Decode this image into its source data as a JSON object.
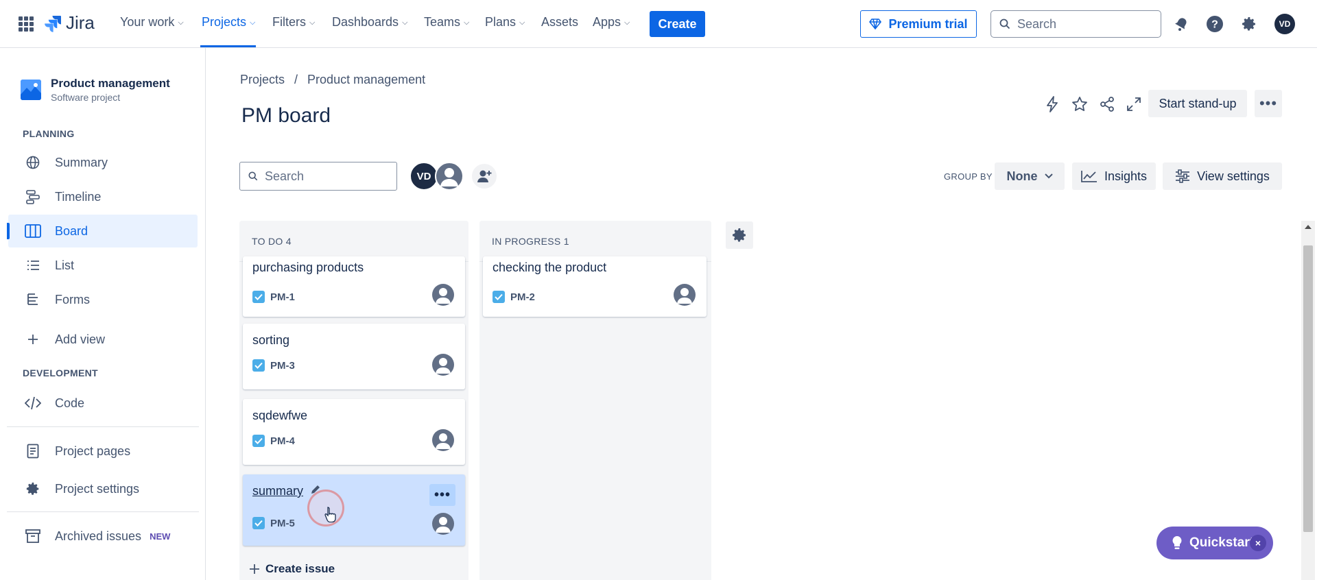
{
  "topnav": {
    "logo_text": "Jira",
    "items": [
      {
        "label": "Your work",
        "chevron": true
      },
      {
        "label": "Projects",
        "chevron": true,
        "active": true
      },
      {
        "label": "Filters",
        "chevron": true
      },
      {
        "label": "Dashboards",
        "chevron": true
      },
      {
        "label": "Teams",
        "chevron": true
      },
      {
        "label": "Plans",
        "chevron": true
      },
      {
        "label": "Assets",
        "chevron": false
      },
      {
        "label": "Apps",
        "chevron": true
      }
    ],
    "create_label": "Create",
    "premium_label": "Premium trial",
    "search_placeholder": "Search",
    "user_initials": "VD",
    "accent_color": "#0c66e4"
  },
  "sidebar": {
    "project_name": "Product management",
    "project_type": "Software project",
    "planning_heading": "PLANNING",
    "planning_items": [
      {
        "label": "Summary",
        "icon": "globe-icon"
      },
      {
        "label": "Timeline",
        "icon": "timeline-icon"
      },
      {
        "label": "Board",
        "icon": "board-icon",
        "active": true
      },
      {
        "label": "List",
        "icon": "list-icon"
      },
      {
        "label": "Forms",
        "icon": "forms-icon"
      }
    ],
    "add_view_label": "Add view",
    "development_heading": "DEVELOPMENT",
    "code_label": "Code",
    "project_pages_label": "Project pages",
    "project_settings_label": "Project settings",
    "archived_label": "Archived issues",
    "archived_badge": "NEW"
  },
  "main": {
    "breadcrumb": [
      "Projects",
      "Product management"
    ],
    "breadcrumb_separator": "/",
    "title": "PM board",
    "standup_label": "Start stand-up",
    "search_placeholder": "Search",
    "member_initials": "VD",
    "group_by_label": "GROUP BY",
    "group_by_value": "None",
    "insights_label": "Insights",
    "view_settings_label": "View settings"
  },
  "board": {
    "columns": [
      {
        "title": "TO DO 4",
        "cards": [
          {
            "title": "purchasing products",
            "key": "PM-1"
          },
          {
            "title": "sorting",
            "key": "PM-3"
          },
          {
            "title": "sqdewfwe",
            "key": "PM-4"
          },
          {
            "title": "summary",
            "key": "PM-5",
            "selected": true
          }
        ],
        "create_label": "Create issue"
      },
      {
        "title": "IN PROGRESS 1",
        "cards": [
          {
            "title": "checking the product",
            "key": "PM-2"
          }
        ]
      }
    ]
  },
  "quickstart": {
    "label": "Quickstart",
    "close": "×"
  }
}
